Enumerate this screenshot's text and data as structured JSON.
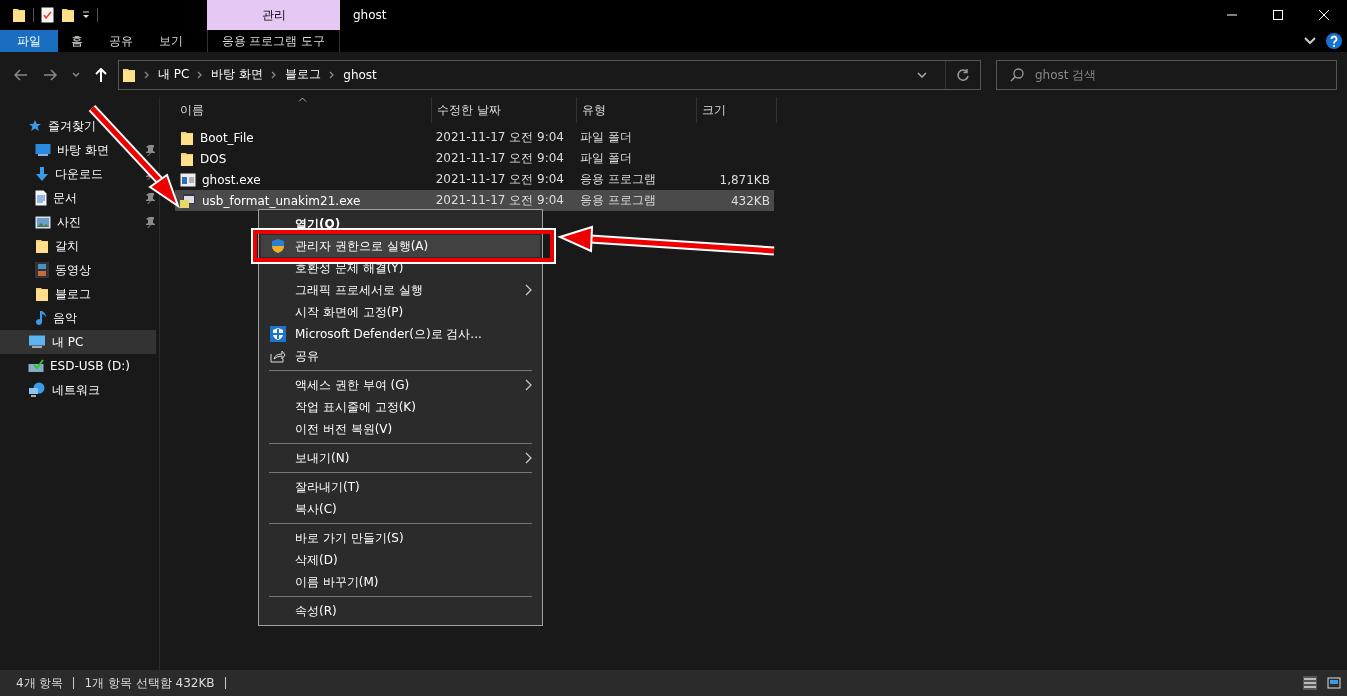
{
  "title_bar": {
    "context_tab": "관리",
    "title": "ghost"
  },
  "ribbon_tabs": [
    {
      "label": "파일",
      "selected": true,
      "kind": "file"
    },
    {
      "label": "홈",
      "selected": false,
      "kind": "tab"
    },
    {
      "label": "공유",
      "selected": false,
      "kind": "tab"
    },
    {
      "label": "보기",
      "selected": false,
      "kind": "tab"
    },
    {
      "label": "응용 프로그램 도구",
      "selected": false,
      "kind": "context"
    }
  ],
  "address_bar": {
    "path": [
      "내 PC",
      "바탕 화면",
      "블로그",
      "ghost"
    ]
  },
  "search": {
    "placeholder": "ghost 검색"
  },
  "navigation": [
    {
      "label": "즐겨찾기",
      "kind": "star",
      "selected": false,
      "children": [
        {
          "label": "바탕 화면",
          "kind": "desktop",
          "pinned": true,
          "selected": false
        },
        {
          "label": "다운로드",
          "kind": "download",
          "pinned": true,
          "selected": false
        },
        {
          "label": "문서",
          "kind": "document",
          "pinned": true,
          "selected": false
        },
        {
          "label": "사진",
          "kind": "photo",
          "pinned": true,
          "selected": false
        },
        {
          "label": "갈치",
          "kind": "folder",
          "selected": false
        },
        {
          "label": "동영상",
          "kind": "video",
          "selected": false
        },
        {
          "label": "블로그",
          "kind": "folder",
          "selected": false
        },
        {
          "label": "음악",
          "kind": "music",
          "selected": false
        }
      ]
    },
    {
      "label": "내 PC",
      "kind": "pc",
      "selected": true
    },
    {
      "label": "ESD-USB (D:)",
      "kind": "drive",
      "selected": false
    },
    {
      "label": "네트워크",
      "kind": "network",
      "selected": false
    }
  ],
  "columns": [
    {
      "label": "이름",
      "sorted": true
    },
    {
      "label": "수정한 날짜",
      "sorted": false
    },
    {
      "label": "유형",
      "sorted": false
    },
    {
      "label": "크기",
      "sorted": false
    }
  ],
  "files": [
    {
      "name": "Boot_File",
      "date": "2021-11-17 오전 9:04",
      "type": "파일 폴더",
      "kind": "folder",
      "selected": false
    },
    {
      "name": "DOS",
      "date": "2021-11-17 오전 9:04",
      "type": "파일 폴더",
      "kind": "folder",
      "selected": false
    },
    {
      "name": "ghost.exe",
      "date": "2021-11-17 오전 9:04",
      "type": "응용 프로그램",
      "size": "1,871KB",
      "kind": "app",
      "selected": false
    },
    {
      "name": "usb_format_unakim21.exe",
      "date": "2021-11-17 오전 9:04",
      "type": "응용 프로그램",
      "size": "432KB",
      "kind": "installer",
      "selected": true
    }
  ],
  "context_menu": {
    "groups": [
      {
        "items": [
          {
            "label": "열기(O)",
            "default": true,
            "highlighted": false
          },
          {
            "label": "관리자 권한으로 실행(A)",
            "kind": "uac",
            "highlighted": true
          },
          {
            "label": "호환성 문제 해결(Y)",
            "highlighted": false
          },
          {
            "label": "그래픽 프로세서로 실행",
            "submenu": true,
            "highlighted": false
          },
          {
            "label": "시작 화면에 고정(P)",
            "highlighted": false
          },
          {
            "label": "Microsoft Defender(으)로 검사...",
            "kind": "defender",
            "highlighted": false
          },
          {
            "label": "공유",
            "kind": "share",
            "highlighted": false
          }
        ]
      },
      {
        "items": [
          {
            "label": "액세스 권한 부여 (G)",
            "submenu": true,
            "highlighted": false
          },
          {
            "label": "작업 표시줄에 고정(K)",
            "highlighted": false
          },
          {
            "label": "이전 버전 복원(V)",
            "highlighted": false
          }
        ]
      },
      {
        "items": [
          {
            "label": "보내기(N)",
            "submenu": true,
            "highlighted": false
          }
        ]
      },
      {
        "items": [
          {
            "label": "잘라내기(T)",
            "highlighted": false
          },
          {
            "label": "복사(C)",
            "highlighted": false
          }
        ]
      },
      {
        "items": [
          {
            "label": "바로 가기 만들기(S)",
            "highlighted": false
          },
          {
            "label": "삭제(D)",
            "highlighted": false
          },
          {
            "label": "이름 바꾸기(M)",
            "highlighted": false
          }
        ]
      },
      {
        "items": [
          {
            "label": "속성(R)",
            "highlighted": false
          }
        ]
      }
    ]
  },
  "status_bar": {
    "item_count": "4개 항목",
    "selection": "1개 항목 선택함 432KB"
  }
}
